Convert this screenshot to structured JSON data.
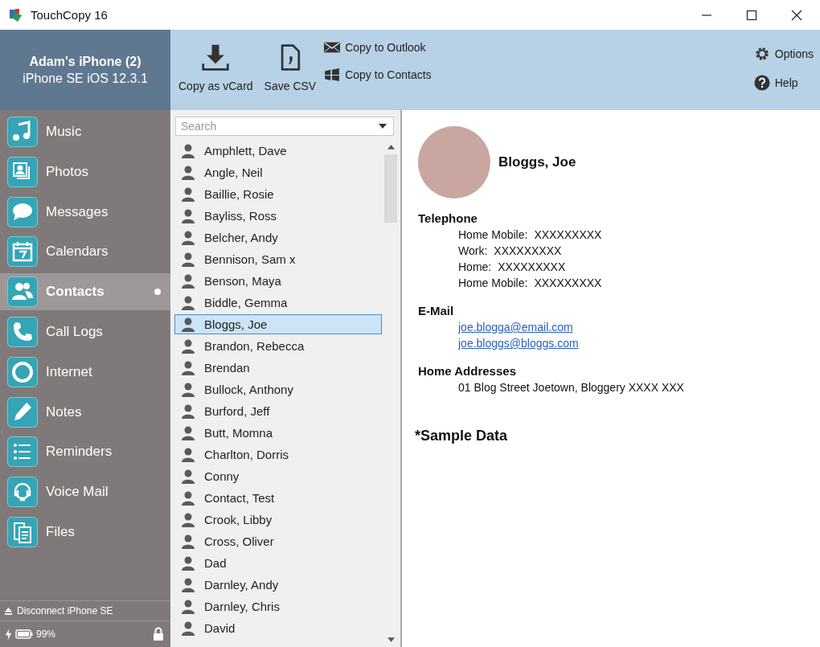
{
  "window": {
    "title": "TouchCopy 16"
  },
  "device": {
    "name": "Adam's iPhone (2)",
    "model": "iPhone SE iOS 12.3.1"
  },
  "toolbar": {
    "big_buttons": [
      {
        "label": "Copy as vCard"
      },
      {
        "label": "Save CSV"
      }
    ],
    "small_buttons": [
      {
        "label": "Copy to Outlook"
      },
      {
        "label": "Copy to Contacts"
      }
    ],
    "right_buttons": [
      {
        "label": "Options"
      },
      {
        "label": "Help"
      }
    ]
  },
  "sidebar": {
    "items": [
      {
        "label": "Music",
        "selected": false
      },
      {
        "label": "Photos",
        "selected": false
      },
      {
        "label": "Messages",
        "selected": false
      },
      {
        "label": "Calendars",
        "selected": false
      },
      {
        "label": "Contacts",
        "selected": true
      },
      {
        "label": "Call Logs",
        "selected": false
      },
      {
        "label": "Internet",
        "selected": false
      },
      {
        "label": "Notes",
        "selected": false
      },
      {
        "label": "Reminders",
        "selected": false
      },
      {
        "label": "Voice Mail",
        "selected": false
      },
      {
        "label": "Files",
        "selected": false
      }
    ],
    "disconnect": "Disconnect iPhone SE",
    "battery": "99%"
  },
  "search": {
    "placeholder": "Search"
  },
  "contacts": [
    {
      "name": "Amphlett, Dave",
      "selected": false
    },
    {
      "name": "Angle, Neil",
      "selected": false
    },
    {
      "name": "Baillie, Rosie",
      "selected": false
    },
    {
      "name": "Bayliss, Ross",
      "selected": false
    },
    {
      "name": "Belcher, Andy",
      "selected": false
    },
    {
      "name": "Bennison, Sam x",
      "selected": false
    },
    {
      "name": "Benson, Maya",
      "selected": false
    },
    {
      "name": "Biddle, Gemma",
      "selected": false
    },
    {
      "name": "Bloggs, Joe",
      "selected": true
    },
    {
      "name": "Brandon, Rebecca",
      "selected": false
    },
    {
      "name": "Brendan",
      "selected": false
    },
    {
      "name": "Bullock, Anthony",
      "selected": false
    },
    {
      "name": "Burford, Jeff",
      "selected": false
    },
    {
      "name": "Butt, Momna",
      "selected": false
    },
    {
      "name": "Charlton, Dorris",
      "selected": false
    },
    {
      "name": "Conny",
      "selected": false
    },
    {
      "name": "Contact, Test",
      "selected": false
    },
    {
      "name": "Crook, Libby",
      "selected": false
    },
    {
      "name": "Cross, Oliver",
      "selected": false
    },
    {
      "name": "Dad",
      "selected": false
    },
    {
      "name": "Darnley, Andy",
      "selected": false
    },
    {
      "name": "Darnley, Chris",
      "selected": false
    },
    {
      "name": "David",
      "selected": false
    }
  ],
  "detail": {
    "name": "Bloggs, Joe",
    "telephone": {
      "heading": "Telephone",
      "entries": [
        {
          "label": "Home Mobile:",
          "value": "XXXXXXXXX"
        },
        {
          "label": "Work:",
          "value": "XXXXXXXXX"
        },
        {
          "label": "Home:",
          "value": "XXXXXXXXX"
        },
        {
          "label": "Home Mobile:",
          "value": "XXXXXXXXX"
        }
      ]
    },
    "email": {
      "heading": "E-Mail",
      "entries": [
        "joe.blogga@email.com",
        "joe.bloggs@bloggs.com"
      ]
    },
    "address": {
      "heading": "Home Addresses",
      "entries": [
        "01 Blog Street Joetown, Bloggery XXXX XXX"
      ]
    },
    "note": "*Sample Data"
  }
}
